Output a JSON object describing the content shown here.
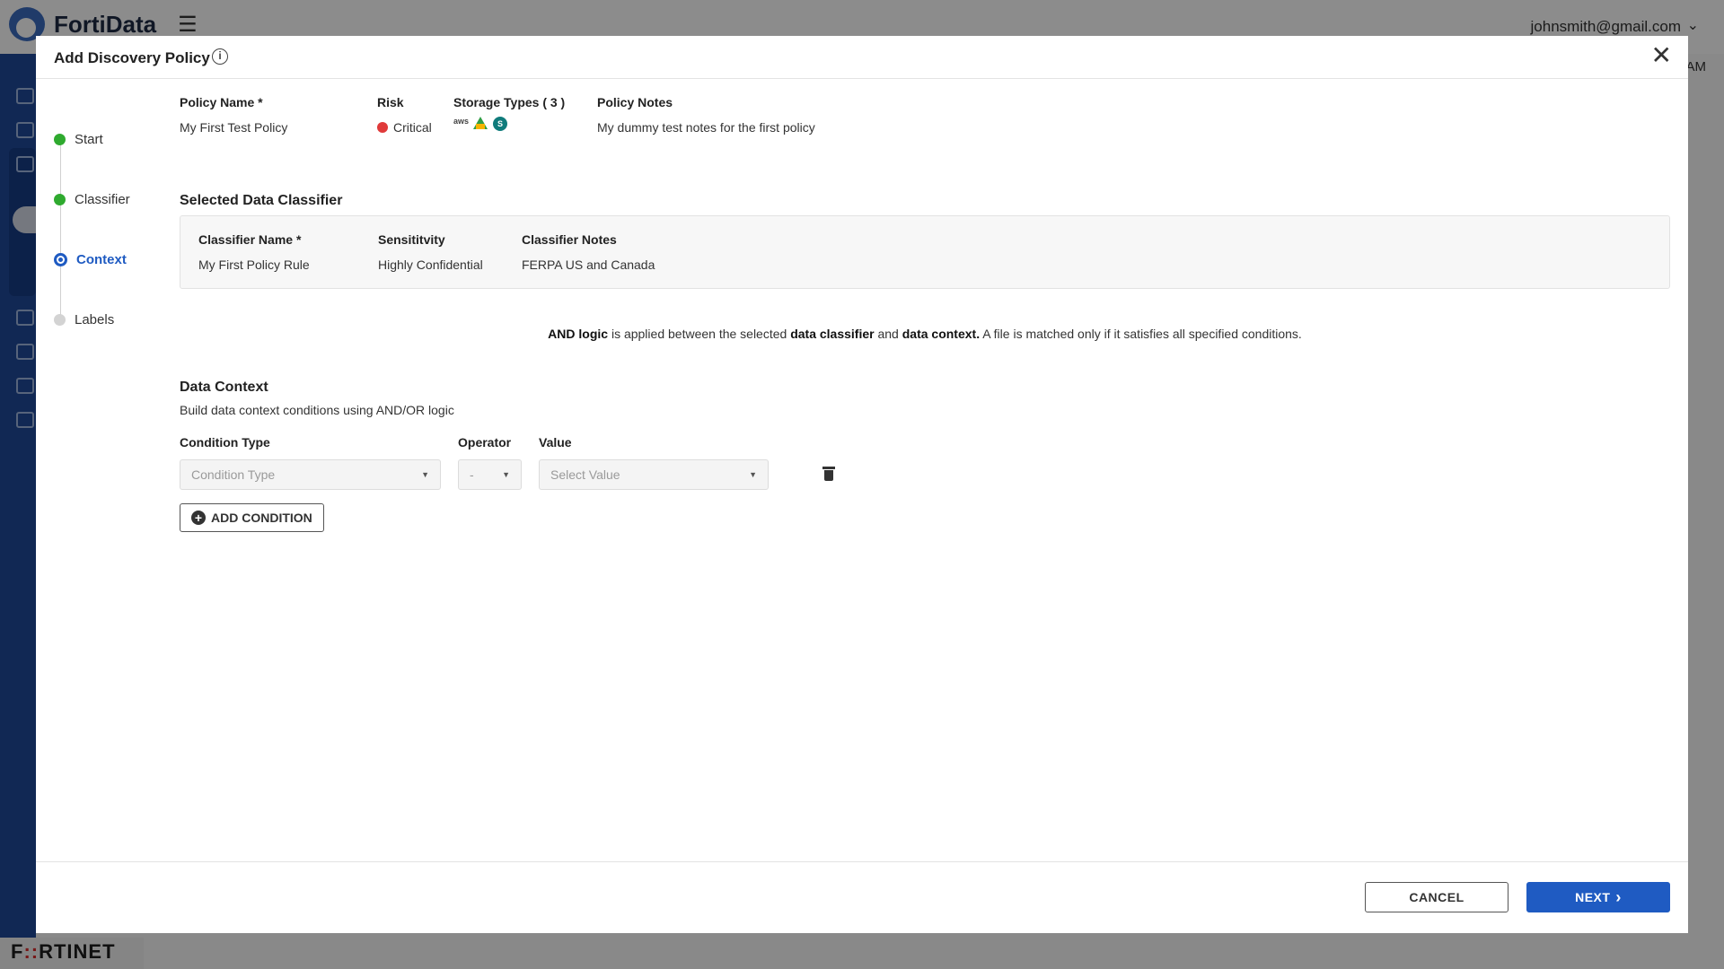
{
  "app": {
    "brand": "FortiData",
    "menu_icon": "collapse-menu-icon",
    "user_email": "johnsmith@gmail.com",
    "time_suffix": "AM",
    "vendor_logo_pre": "F",
    "vendor_logo_mid": "::",
    "vendor_logo_post": "RTINET"
  },
  "modal": {
    "title": "Add Discovery Policy",
    "info_icon": "i",
    "close_label": "✕"
  },
  "steps": [
    {
      "label": "Start",
      "state": "done"
    },
    {
      "label": "Classifier",
      "state": "done"
    },
    {
      "label": "Context",
      "state": "current"
    },
    {
      "label": "Labels",
      "state": "pending"
    }
  ],
  "summary": {
    "policy_name_label": "Policy Name *",
    "policy_name": "My First Test Policy",
    "risk_label": "Risk",
    "risk": "Critical",
    "risk_color": "#e03a3a",
    "storage_label": "Storage Types ( 3 )",
    "storage_icons": [
      "aws-icon",
      "google-drive-icon",
      "sharepoint-icon"
    ],
    "aws_text": "aws",
    "sharepoint_text": "S",
    "notes_label": "Policy Notes",
    "notes": "My dummy test notes for the first policy"
  },
  "classifier": {
    "section_title": "Selected Data Classifier",
    "name_label": "Classifier Name *",
    "name": "My First Policy Rule",
    "sensitivity_label": "Sensititvity",
    "sensitivity": "Highly Confidential",
    "notes_label": "Classifier Notes",
    "notes": "FERPA US and Canada"
  },
  "logic_note": {
    "b1": "AND logic",
    "t1": " is applied between the selected ",
    "b2": "data classifier",
    "t2": " and ",
    "b3": "data context.",
    "t3": " A file is matched only if it satisfies all specified conditions."
  },
  "data_context": {
    "title": "Data Context",
    "subtitle": "Build data context conditions using AND/OR logic",
    "condition_type_label": "Condition Type",
    "operator_label": "Operator",
    "value_label": "Value",
    "condition_type_placeholder": "Condition Type",
    "operator_placeholder": "-",
    "value_placeholder": "Select Value",
    "add_condition_label": "ADD CONDITION"
  },
  "footer": {
    "cancel_label": "CANCEL",
    "next_label": "NEXT",
    "next_icon": "›"
  },
  "colors": {
    "primary": "#1f5bc2",
    "done": "#2faa2f",
    "sidebar": "#1f4a9a"
  }
}
